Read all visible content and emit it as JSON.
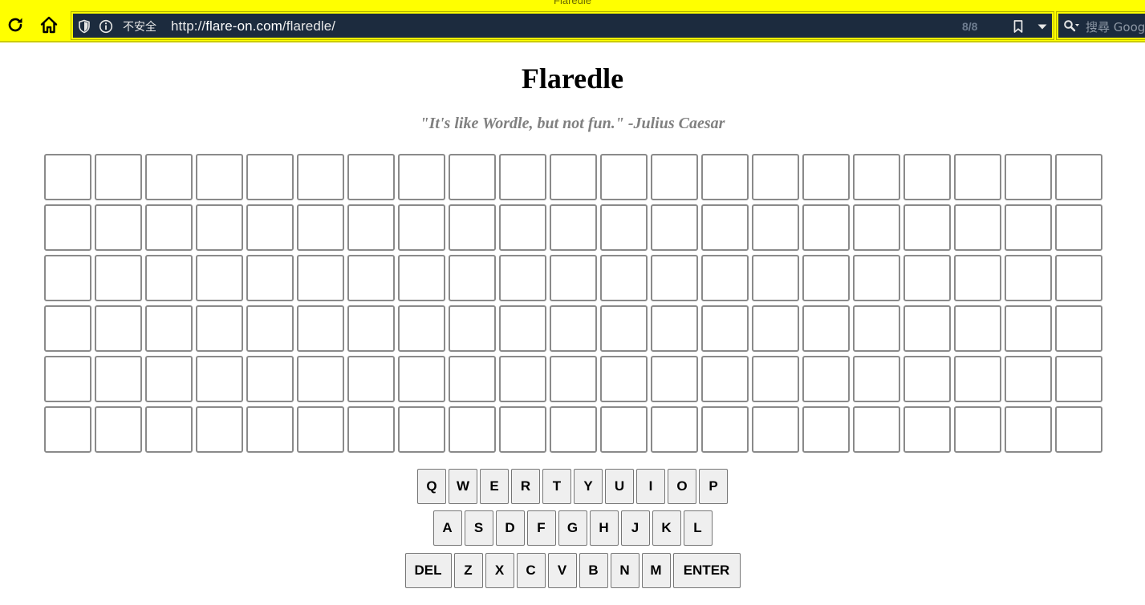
{
  "browser": {
    "window_title": "Flaredle",
    "url_security_label": "不安全",
    "url_prefix": "http://",
    "url_host": "flare-on.com",
    "url_path": "/flaredle/",
    "match_counter": "8/8",
    "search_placeholder": "搜尋 Goog"
  },
  "page": {
    "title": "Flaredle",
    "tagline": "\"It's like Wordle, but not fun.\" -Julius Caesar"
  },
  "board": {
    "rows": 6,
    "columns": 21,
    "tiles": [
      [
        "",
        "",
        "",
        "",
        "",
        "",
        "",
        "",
        "",
        "",
        "",
        "",
        "",
        "",
        "",
        "",
        "",
        "",
        "",
        "",
        ""
      ],
      [
        "",
        "",
        "",
        "",
        "",
        "",
        "",
        "",
        "",
        "",
        "",
        "",
        "",
        "",
        "",
        "",
        "",
        "",
        "",
        "",
        ""
      ],
      [
        "",
        "",
        "",
        "",
        "",
        "",
        "",
        "",
        "",
        "",
        "",
        "",
        "",
        "",
        "",
        "",
        "",
        "",
        "",
        "",
        ""
      ],
      [
        "",
        "",
        "",
        "",
        "",
        "",
        "",
        "",
        "",
        "",
        "",
        "",
        "",
        "",
        "",
        "",
        "",
        "",
        "",
        "",
        ""
      ],
      [
        "",
        "",
        "",
        "",
        "",
        "",
        "",
        "",
        "",
        "",
        "",
        "",
        "",
        "",
        "",
        "",
        "",
        "",
        "",
        "",
        ""
      ],
      [
        "",
        "",
        "",
        "",
        "",
        "",
        "",
        "",
        "",
        "",
        "",
        "",
        "",
        "",
        "",
        "",
        "",
        "",
        "",
        "",
        ""
      ]
    ]
  },
  "keyboard": {
    "rows": [
      [
        "Q",
        "W",
        "E",
        "R",
        "T",
        "Y",
        "U",
        "I",
        "O",
        "P"
      ],
      [
        "A",
        "S",
        "D",
        "F",
        "G",
        "H",
        "J",
        "K",
        "L"
      ],
      [
        "DEL",
        "Z",
        "X",
        "C",
        "V",
        "B",
        "N",
        "M",
        "ENTER"
      ]
    ]
  },
  "colors": {
    "chrome_background": "#ffff00",
    "urlbar_background": "#1c2b3e",
    "tile_border": "#8a8a8a",
    "tagline_text": "#808080",
    "key_background": "#efefef"
  }
}
